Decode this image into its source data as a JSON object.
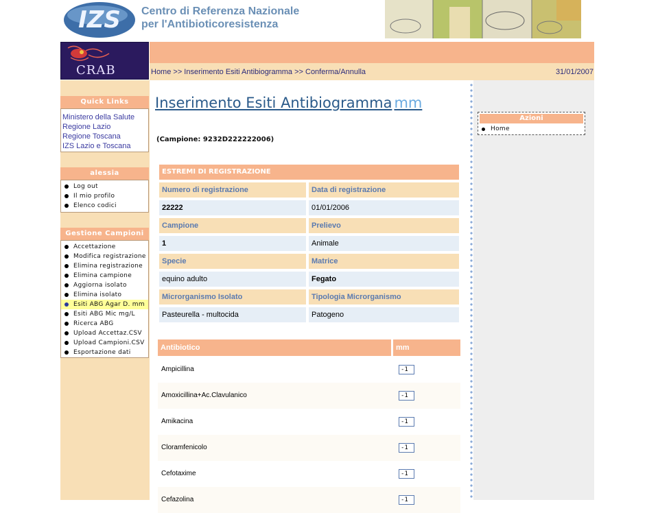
{
  "header": {
    "logo_text": "IZS",
    "title_line1": "Centro di Referenza Nazionale",
    "title_line2": "per l'Antibioticoresistenza"
  },
  "brand": {
    "crab_label": "CRAB"
  },
  "breadcrumb": {
    "text": "Home >> Inserimento Esiti Antibiogramma >> Conferma/Annulla",
    "date": "31/01/2007"
  },
  "sidebar": {
    "quick_links": {
      "title": "Quick Links",
      "items": [
        "Ministero della Salute",
        "Regione Lazio",
        "Regione Toscana",
        "IZS Lazio e Toscana"
      ]
    },
    "user": {
      "title": "alessia",
      "items": [
        "Log out",
        "Il mio profilo",
        "Elenco codici"
      ]
    },
    "gestione": {
      "title": "Gestione Campioni",
      "items": [
        "Accettazione",
        "Modifica registrazione",
        "Elimina registrazione",
        "Elimina campione",
        "Aggiorna isolato",
        "Elimina isolato",
        "Esiti ABG Agar D. mm",
        "Esiti ABG Mic mg/L",
        "Ricerca ABG",
        "Upload Accettaz.CSV",
        "Upload Campioni.CSV",
        "Esportazione dati"
      ],
      "selected_index": 6
    }
  },
  "actions": {
    "title": "Azioni",
    "items": [
      "Home"
    ]
  },
  "main": {
    "title": "Inserimento Esiti Antibiogramma",
    "title_unit": "mm",
    "campione": "(Campione: 9232D222222006)",
    "section_title": "ESTREMI DI REGISTRAZIONE",
    "fields": [
      {
        "label1": "Numero di registrazione",
        "label2": "Data di registrazione",
        "value1": "22222",
        "value2": "01/01/2006"
      },
      {
        "label1": "Campione",
        "label2": "Prelievo",
        "value1": "1",
        "value2": "Animale"
      },
      {
        "label1": "Specie",
        "label2": "Matrice",
        "value1": "equino adulto",
        "value2": "Fegato"
      },
      {
        "label1": "Microrganismo Isolato",
        "label2": "Tipologia Microrganismo",
        "value1": "Pasteurella - multocida",
        "value2": "Patogeno"
      }
    ],
    "table": {
      "col_antibiotico": "Antibiotico",
      "col_mm": "mm",
      "rows": [
        {
          "name": "Ampicillina",
          "value": "-1"
        },
        {
          "name": "Amoxicillina+Ac.Clavulanico",
          "value": "-1"
        },
        {
          "name": "Amikacina",
          "value": "-1"
        },
        {
          "name": "Cloramfenicolo",
          "value": "-1"
        },
        {
          "name": "Cefotaxime",
          "value": "-1"
        },
        {
          "name": "Cefazolina",
          "value": "-1"
        }
      ]
    }
  },
  "colors": {
    "accent": "#f7b48c",
    "panel": "#f8dfb6",
    "link": "#2a5a8a"
  }
}
